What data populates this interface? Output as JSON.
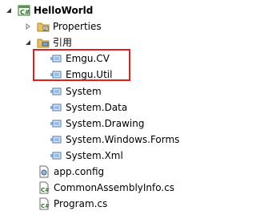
{
  "project": {
    "name": "HelloWorld",
    "icon": "csharp-project-icon"
  },
  "tree": {
    "properties": {
      "label": "Properties",
      "icon": "properties-folder-icon"
    },
    "references": {
      "label": "引用",
      "icon": "references-folder-icon",
      "items": [
        {
          "label": "Emgu.CV",
          "icon": "reference-icon"
        },
        {
          "label": "Emgu.Util",
          "icon": "reference-icon"
        },
        {
          "label": "System",
          "icon": "reference-icon"
        },
        {
          "label": "System.Data",
          "icon": "reference-icon"
        },
        {
          "label": "System.Drawing",
          "icon": "reference-icon"
        },
        {
          "label": "System.Windows.Forms",
          "icon": "reference-icon"
        },
        {
          "label": "System.Xml",
          "icon": "reference-icon"
        }
      ]
    },
    "files": [
      {
        "label": "app.config",
        "icon": "config-file-icon"
      },
      {
        "label": "CommonAssemblyInfo.cs",
        "icon": "csharp-file-icon"
      },
      {
        "label": "Program.cs",
        "icon": "csharp-file-icon"
      }
    ]
  },
  "highlight": {
    "color": "#e02020"
  }
}
